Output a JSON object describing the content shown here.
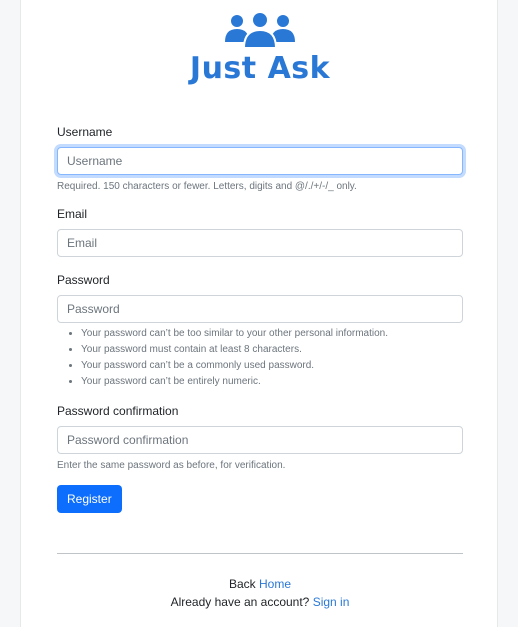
{
  "brand": {
    "name": "Just Ask",
    "icon": "users-group-icon",
    "color": "#2a78d6"
  },
  "form": {
    "username": {
      "label": "Username",
      "placeholder": "Username",
      "help": "Required. 150 characters or fewer. Letters, digits and @/./+/-/_ only."
    },
    "email": {
      "label": "Email",
      "placeholder": "Email"
    },
    "password": {
      "label": "Password",
      "placeholder": "Password",
      "rules": [
        "Your password can’t be too similar to your other personal information.",
        "Your password must contain at least 8 characters.",
        "Your password can’t be a commonly used password.",
        "Your password can’t be entirely numeric."
      ]
    },
    "password_confirm": {
      "label": "Password confirmation",
      "placeholder": "Password confirmation",
      "help": "Enter the same password as before, for verification."
    },
    "submit_label": "Register"
  },
  "footer": {
    "back_text": "Back",
    "home_link": "Home",
    "account_text": "Already have an account?",
    "signin_link": "Sign in"
  },
  "colors": {
    "primary": "#0d6efd",
    "link": "#2a78d6"
  }
}
